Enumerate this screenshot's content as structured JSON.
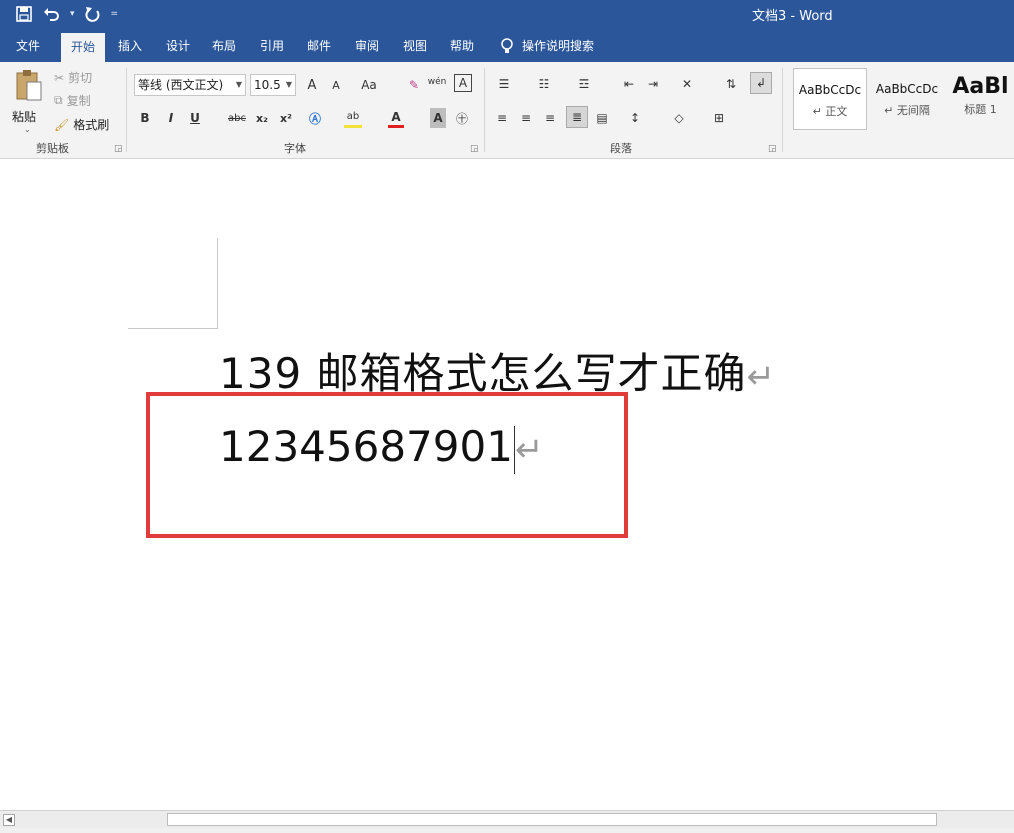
{
  "window": {
    "title": "文档3  -  Word"
  },
  "quick_access": {
    "save_icon": "save-icon",
    "undo_icon": "undo-icon",
    "redo_icon": "redo-icon",
    "customize": "="
  },
  "tabs": [
    {
      "label": "文件"
    },
    {
      "label": "开始"
    },
    {
      "label": "插入"
    },
    {
      "label": "设计"
    },
    {
      "label": "布局"
    },
    {
      "label": "引用"
    },
    {
      "label": "邮件"
    },
    {
      "label": "审阅"
    },
    {
      "label": "视图"
    },
    {
      "label": "帮助"
    }
  ],
  "tell_me": "操作说明搜索",
  "clipboard": {
    "paste": "粘贴",
    "cut": "剪切",
    "copy": "复制",
    "format_painter": "格式刷",
    "group_label": "剪贴板"
  },
  "font": {
    "family": "等线 (西文正文)",
    "size": "10.5",
    "group_label": "字体",
    "bold": "B",
    "italic": "I",
    "underline": "U",
    "strike": "abc",
    "subscript": "x₂",
    "superscript": "x²",
    "change_case": "Aa",
    "grow": "A",
    "shrink": "A",
    "phonetic": "wén",
    "border": "A"
  },
  "paragraph": {
    "group_label": "段落"
  },
  "styles": [
    {
      "sample": "AaBbCcDc",
      "name": "↵ 正文"
    },
    {
      "sample": "AaBbCcDc",
      "name": "↵ 无间隔"
    },
    {
      "sample": "AaBl",
      "name": "标题 1"
    }
  ],
  "document": {
    "line1": "139 邮箱格式怎么写才正确",
    "line2": "12345687901",
    "para_mark": "↵"
  },
  "colors": {
    "brand": "#2b579a",
    "highlight_box": "#e23b3b"
  }
}
